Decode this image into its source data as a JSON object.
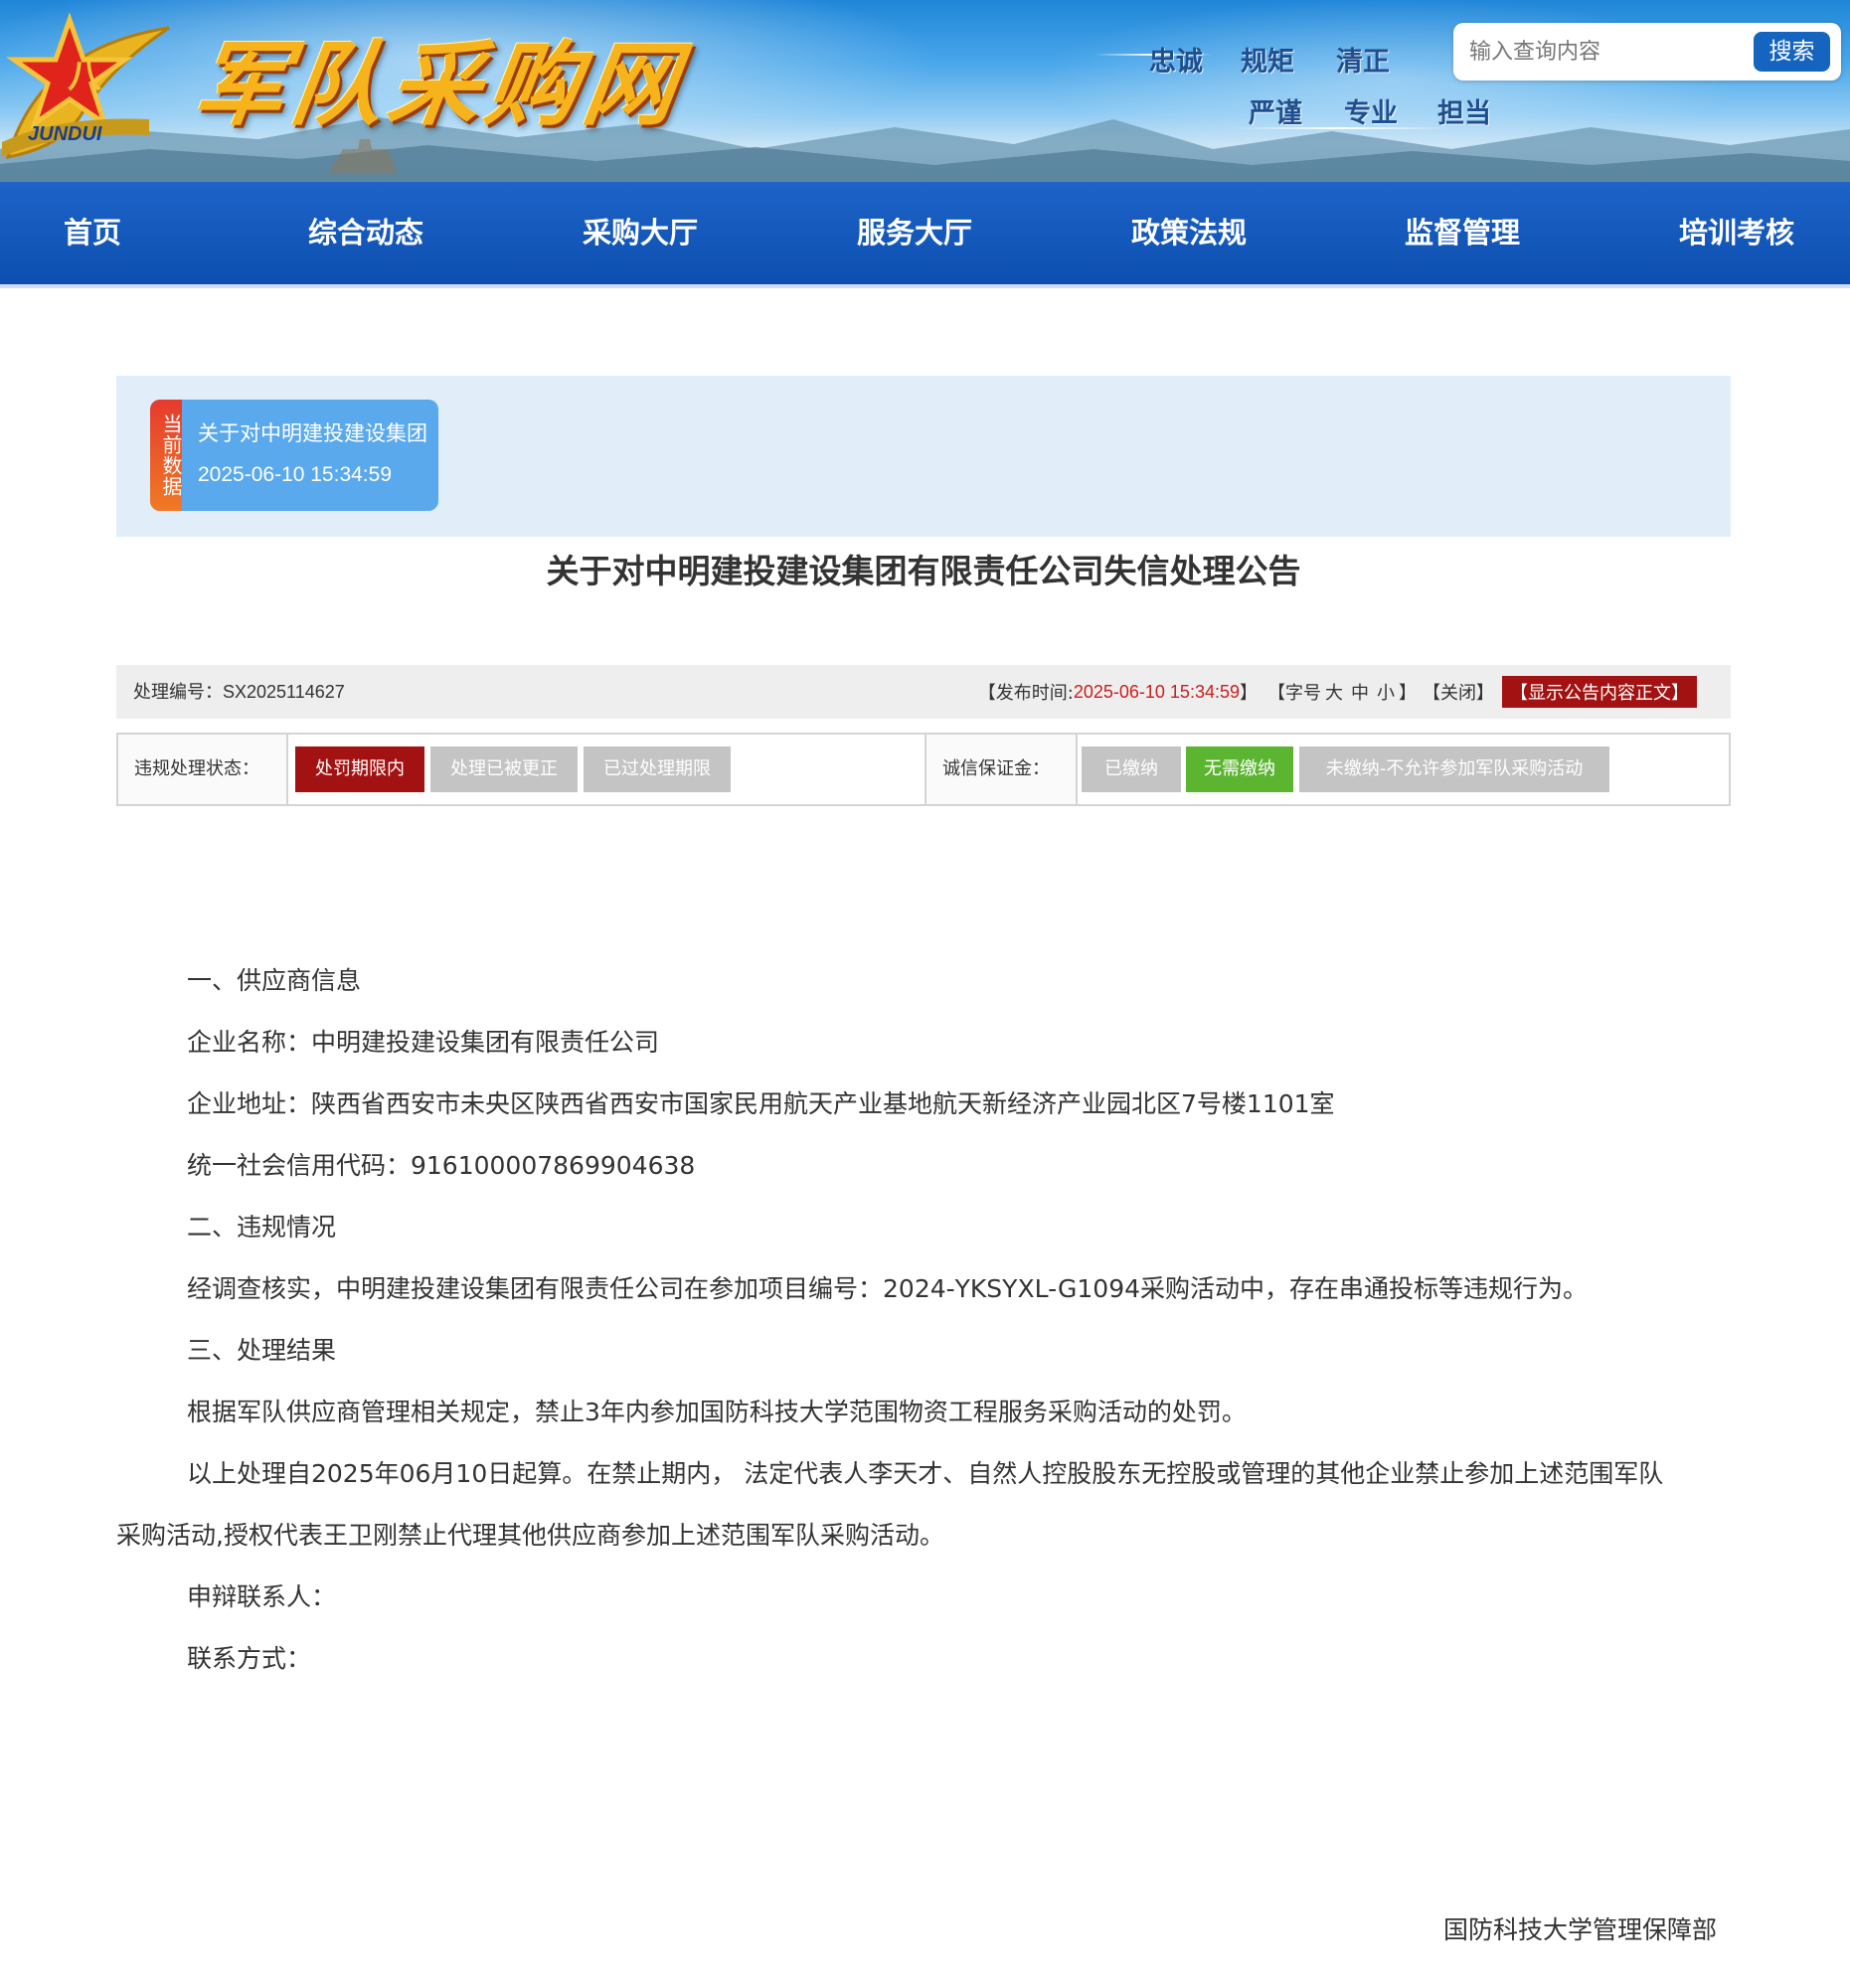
{
  "header": {
    "site_title": "军队采购网",
    "logo_text": "JUNDUI",
    "mottos": [
      "忠诚",
      "规矩",
      "清正",
      "严谨",
      "专业",
      "担当"
    ],
    "search": {
      "placeholder": "输入查询内容",
      "button_label": "搜索"
    }
  },
  "nav": {
    "items": [
      "首页",
      "综合动态",
      "采购大厅",
      "服务大厅",
      "政策法规",
      "监督管理",
      "培训考核"
    ]
  },
  "current": {
    "tag": "当前数据",
    "title": "关于对中明建投建设集团",
    "date": "2025-06-10 15:34:59"
  },
  "notice": {
    "title": "关于对中明建投建设集团有限责任公司失信处理公告",
    "info_bar": {
      "id_label": "处理编号：",
      "id_value": "SX2025114627",
      "publish_prefix": "【发布时间:",
      "publish_time": "2025-06-10 15:34:59",
      "publish_suffix": "】",
      "font_prefix": "【字号",
      "font_sizes": [
        "大",
        "中",
        "小"
      ],
      "font_suffix": "】",
      "close_label": "【关闭】",
      "show_label": "【显示公告内容正文】"
    },
    "status": {
      "violation_label": "违规处理状态：",
      "violation_options": [
        {
          "label": "处罚期限内",
          "active": true,
          "color": "#a31212"
        },
        {
          "label": "处理已被更正",
          "active": false,
          "color": "#c4c4c4"
        },
        {
          "label": "已过处理期限",
          "active": false,
          "color": "#c4c4c4"
        }
      ],
      "deposit_label": "诚信保证金：",
      "deposit_options": [
        {
          "label": "已缴纳",
          "active": false,
          "color": "#c4c4c4"
        },
        {
          "label": "无需缴纳",
          "active": true,
          "color": "#5cb531"
        },
        {
          "label": "未缴纳-不允许参加军队采购活动",
          "active": false,
          "color": "#c4c4c4"
        }
      ]
    },
    "body": {
      "s1_heading": "一、供应商信息",
      "company_name": "企业名称：中明建投建设集团有限责任公司",
      "company_address": "企业地址：陕西省西安市未央区陕西省西安市国家民用航天产业基地航天新经济产业园北区7号楼1101室",
      "credit_code": "统一社会信用代码：916100007869904638",
      "s2_heading": "二、违规情况",
      "violation_text": "经调查核实，中明建投建设集团有限责任公司在参加项目编号：2024-YKSYXL-G1094采购活动中，存在串通投标等违规行为。",
      "s3_heading": "三、处理结果",
      "result_text": "根据军队供应商管理相关规定，禁止3年内参加国防科技大学范围物资工程服务采购活动的处罚。",
      "period_text_line1": "以上处理自2025年06月10日起算。在禁止期内，  法定代表人李天才、自然人控股股东无控股或管理的其他企业禁止参加上述范围军队",
      "period_text_line2": "采购活动,授权代表王卫刚禁止代理其他供应商参加上述范围军队采购活动。",
      "appeal_contact": "申辩联系人：",
      "contact_method": "联系方式："
    },
    "signature": "国防科技大学管理保障部"
  },
  "colors": {
    "nav_blue": "#0c4fb0",
    "accent_red": "#c8201d",
    "active_red": "#a31212",
    "active_green": "#5cb531",
    "inactive_gray": "#c4c4c4",
    "strip_bg": "#e1eefa"
  }
}
